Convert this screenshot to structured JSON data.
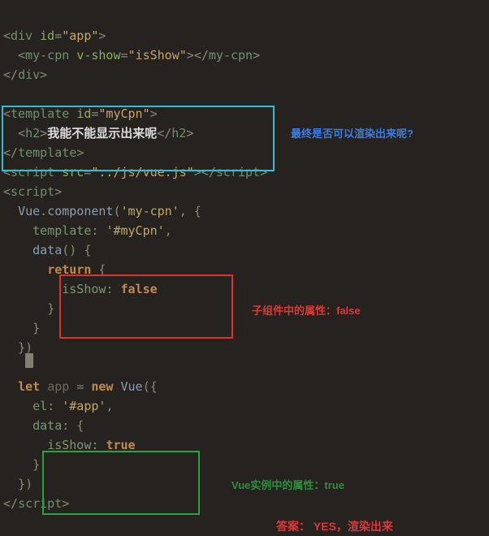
{
  "code": {
    "l1_pre": "<",
    "l1_tag": "div",
    "l1_sp": " ",
    "l1_attr": "id",
    "l1_eq": "=",
    "l1_val": "\"app\"",
    "l1_end": ">",
    "l2_indent": "  ",
    "l2_o": "<",
    "l2_tag": "my-cpn",
    "l2_sp": " ",
    "l2_attr": "v-show",
    "l2_eq": "=",
    "l2_val": "\"isShow\"",
    "l2_oe": ">",
    "l2_co": "</",
    "l2_ctag": "my-cpn",
    "l2_ce": ">",
    "l3_o": "</",
    "l3_tag": "div",
    "l3_c": ">",
    "blank1": " ",
    "l5_o": "<",
    "l5_tag": "template",
    "l5_sp": " ",
    "l5_attr": "id",
    "l5_eq": "=",
    "l5_val": "\"myCpn\"",
    "l5_c": ">",
    "l6_indent": "  ",
    "l6_o": "<",
    "l6_tag": "h2",
    "l6_oe": ">",
    "l6_txt": "我能不能显示出来呢",
    "l6_co": "</",
    "l6_ctag": "h2",
    "l6_ce": ">",
    "l7_o": "</",
    "l7_tag": "template",
    "l7_c": ">",
    "l8_o": "<",
    "l8_tag": "script",
    "l8_sp": " ",
    "l8_attr": "src",
    "l8_eq": "=",
    "l8_val": "\"../js/vue.js\"",
    "l8_oe": ">",
    "l8_co": "</",
    "l8_ctag": "script",
    "l8_ce": ">",
    "l9_o": "<",
    "l9_tag": "script",
    "l9_c": ">",
    "l10_indent": "  ",
    "l10_obj": "Vue",
    "l10_dot": ".",
    "l10_fn": "component",
    "l10_par": "(",
    "l10_str": "'my-cpn'",
    "l10_com": ", {",
    "l11_indent": "    ",
    "l11_key": "template",
    "l11_col": ": ",
    "l11_val": "'#myCpn'",
    "l11_com": ",",
    "l12_indent": "    ",
    "l12_fn": "data",
    "l12_par": "() {",
    "l13_indent": "      ",
    "l13_kw": "return",
    "l13_sp": " {",
    "l14_indent": "        ",
    "l14_key": "isShow",
    "l14_col": ": ",
    "l14_val": "false",
    "l15_indent": "      ",
    "l15_cb": "}",
    "l16_indent": "    ",
    "l16_cb": "}",
    "l17_indent": "  ",
    "l17_cb": "})",
    "blank2": " ",
    "l19_indent": "  ",
    "l19_kw": "let",
    "l19_sp": " ",
    "l19_var": "app",
    "l19_eq": " = ",
    "l19_kw2": "new",
    "l19_sp2": " ",
    "l19_cls": "Vue",
    "l19_par": "({",
    "l20_indent": "    ",
    "l20_key": "el",
    "l20_col": ": ",
    "l20_val": "'#app'",
    "l20_com": ",",
    "l21_indent": "    ",
    "l21_key": "data",
    "l21_col": ": {",
    "l22_indent": "      ",
    "l22_key": "isShow",
    "l22_col": ": ",
    "l22_val": "true",
    "l23_indent": "    ",
    "l23_cb": "}",
    "l24_indent": "  ",
    "l24_cb": "})",
    "l25_o": "</",
    "l25_tag": "script",
    "l25_c": ">"
  },
  "anno": {
    "q": "最终是否可以渲染出来呢?",
    "child": "子组件中的属性：false",
    "vue": "Vue实例中的属性：true",
    "ans": "答案： YES，渲染出来"
  }
}
